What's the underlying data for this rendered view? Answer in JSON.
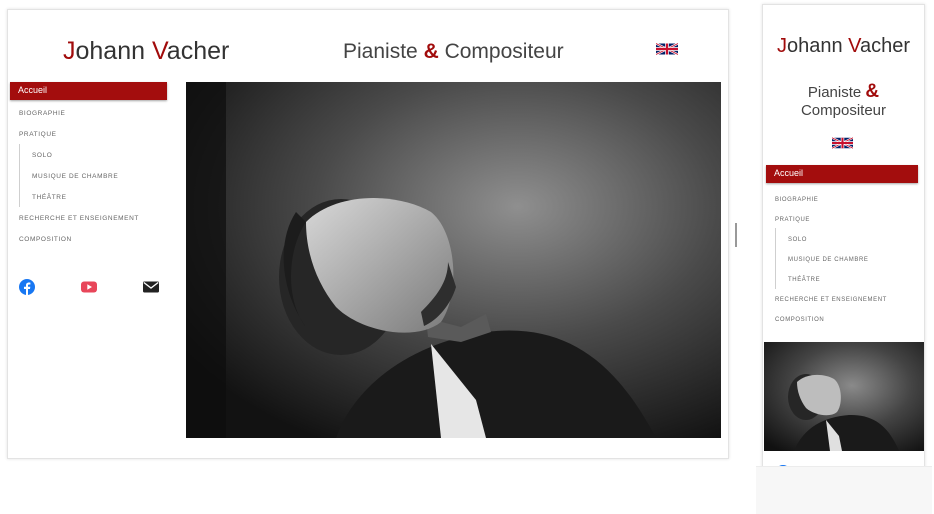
{
  "site": {
    "brand": {
      "initial_first": "J",
      "rest_first": "ohann ",
      "initial_last": "V",
      "rest_last": "acher"
    },
    "tagline": {
      "word1": "Pianiste",
      "amp": "&",
      "word2": "Compositeur"
    },
    "language_flag": "uk-flag-icon"
  },
  "menu": {
    "active": "Accueil",
    "items": [
      {
        "label": "Biographie",
        "sub": false
      },
      {
        "label": "Pratique",
        "sub": false
      },
      {
        "label": "Solo",
        "sub": true
      },
      {
        "label": "Musique de chambre",
        "sub": true
      },
      {
        "label": "Théâtre",
        "sub": true
      },
      {
        "label": "Recherche et enseignement",
        "sub": false
      },
      {
        "label": "Composition",
        "sub": false
      }
    ]
  },
  "social": {
    "icons": [
      "facebook-icon",
      "youtube-icon",
      "mail-icon"
    ],
    "colors": {
      "facebook": "#1877f2",
      "youtube": "#e8465a",
      "mail": "#222222"
    }
  },
  "colors": {
    "accent": "#a30d0d",
    "text": "#333333",
    "menu_text": "#666666"
  }
}
